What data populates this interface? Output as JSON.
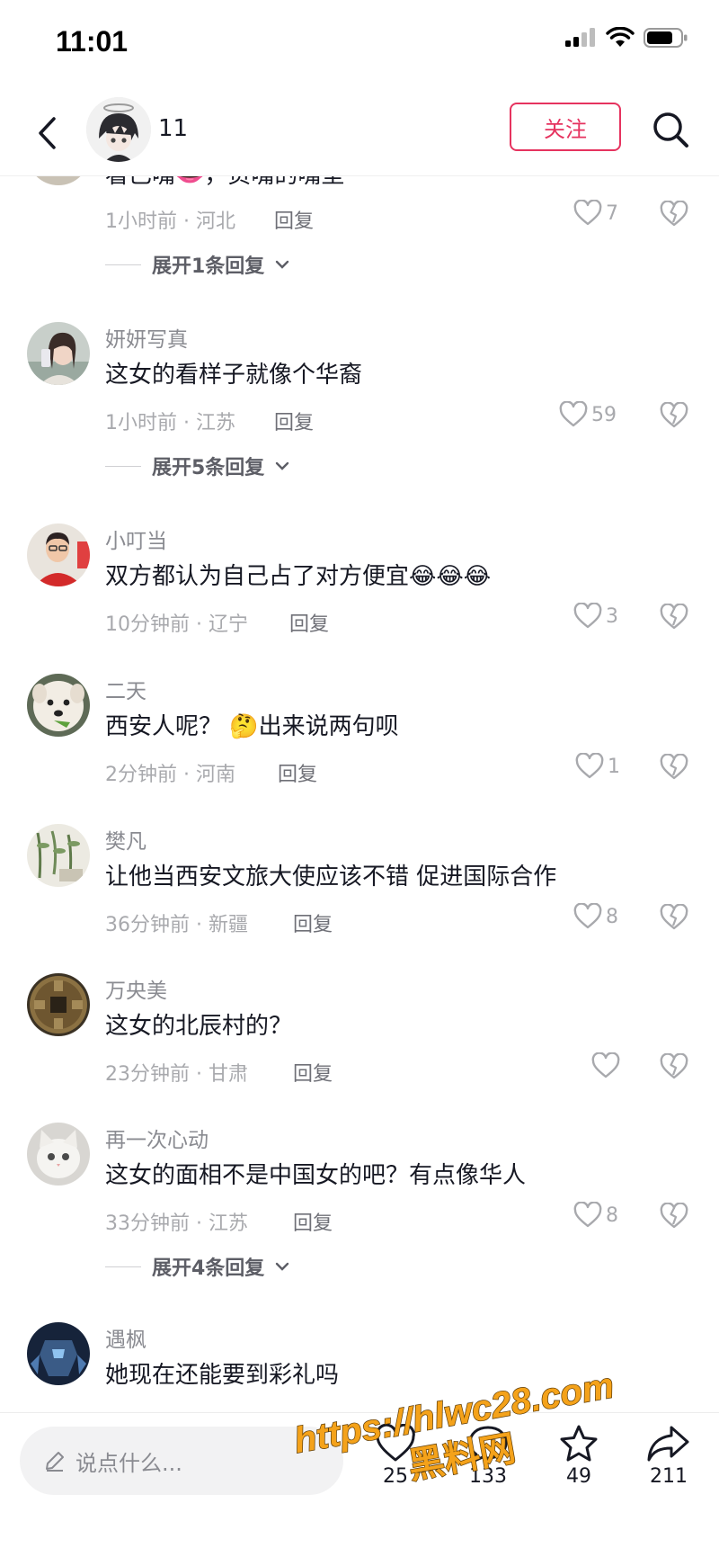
{
  "status_bar": {
    "time": "11:01"
  },
  "header": {
    "name": "11",
    "follow_label": "关注"
  },
  "partial_comment": {
    "text": "看已嘴👄，贞嘴的嘴垒",
    "meta": "1小时前 · 河北",
    "reply": "回复",
    "likes": "7",
    "expand": "展开1条回复"
  },
  "comments": [
    {
      "name": "妍妍写真",
      "text": "这女的看样子就像个华裔",
      "meta": "1小时前 · 江苏",
      "reply": "回复",
      "likes": "59",
      "expand": "展开5条回复"
    },
    {
      "name": "小叮当",
      "text": "双方都认为自己占了对方便宜😂😂😂",
      "meta": "10分钟前 · 辽宁",
      "reply": "回复",
      "likes": "3"
    },
    {
      "name": "二天",
      "text": "西安人呢？ 🤔出来说两句呗",
      "meta": "2分钟前 · 河南",
      "reply": "回复",
      "likes": "1"
    },
    {
      "name": "樊凡",
      "text": "让他当西安文旅大使应该不错 促进国际合作",
      "meta": "36分钟前 · 新疆",
      "reply": "回复",
      "likes": "8"
    },
    {
      "name": "万央美",
      "text": "这女的北辰村的？",
      "meta": "23分钟前 · 甘肃",
      "reply": "回复",
      "likes": ""
    },
    {
      "name": "再一次心动",
      "text": "这女的面相不是中国女的吧？有点像华人",
      "meta": "33分钟前 · 江苏",
      "reply": "回复",
      "likes": "8",
      "expand": "展开4条回复"
    },
    {
      "name": "遇枫",
      "text": "她现在还能要到彩礼吗"
    }
  ],
  "bottom_bar": {
    "placeholder": "说点什么...",
    "like_count": "25",
    "comment_count": "133",
    "favorite_count": "49",
    "share_count": "211"
  },
  "watermark": {
    "line1": "https://hlwc28.com",
    "line2": "黑料网"
  },
  "colors": {
    "accent": "#e6335f",
    "text": "#161823",
    "muted": "#a8a9ad",
    "name": "#8a8b91",
    "watermark": "#f4a21a"
  }
}
